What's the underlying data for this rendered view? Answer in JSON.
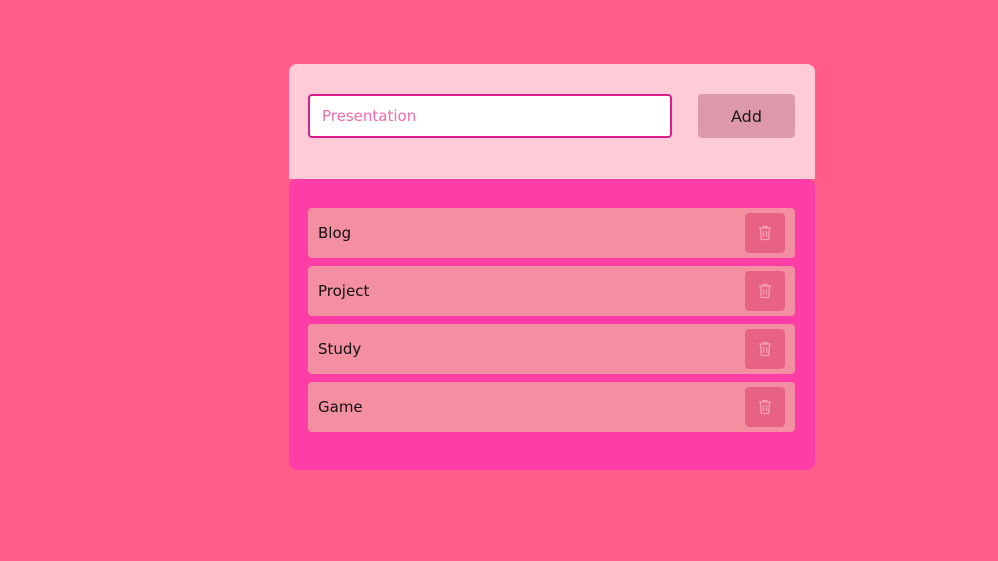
{
  "input": {
    "placeholder": "Presentation",
    "value": ""
  },
  "add_button": {
    "label": "Add"
  },
  "tasks": [
    {
      "label": "Blog",
      "action_icon": "trash-icon"
    },
    {
      "label": "Project",
      "action_icon": "trash-icon"
    },
    {
      "label": "Study",
      "action_icon": "trash-icon"
    },
    {
      "label": "Game",
      "action_icon": "trash-icon"
    }
  ],
  "colors": {
    "page_background": "#ff5c8a",
    "input_panel": "#ffcbd6",
    "list_panel": "#ff3da6",
    "task_item": "#f48fa1",
    "delete_button": "#e86285",
    "add_button": "#dd99ab",
    "input_border": "#e01b8a"
  }
}
